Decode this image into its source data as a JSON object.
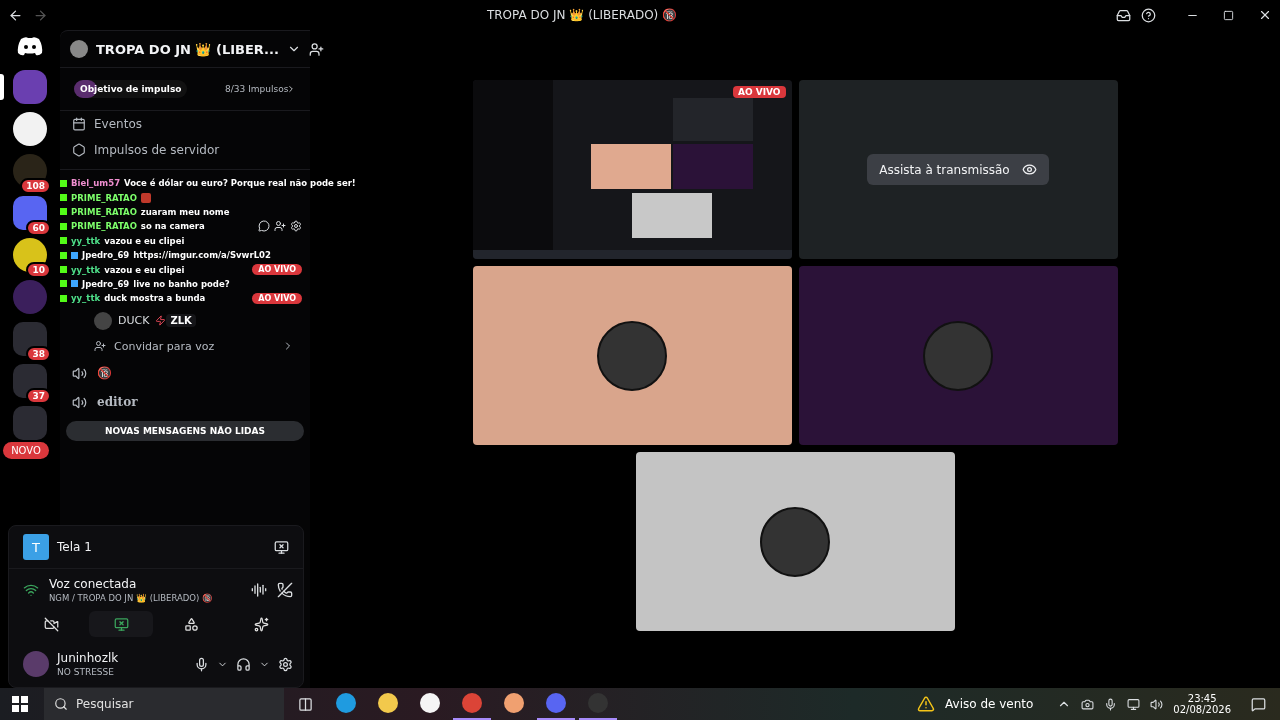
{
  "window": {
    "title": "TROPA DO JN 👑 (LIBERADO) 🔞"
  },
  "servers": [
    {
      "kind": "avatar",
      "selected": true,
      "color": "#6a3fb0"
    },
    {
      "kind": "logo",
      "selected": false,
      "color": "#f2f2f2"
    },
    {
      "kind": "logo",
      "selected": false,
      "color": "#2a2418",
      "badge": "108"
    },
    {
      "kind": "folder",
      "selected": false,
      "color": "#5865f2",
      "badge": "60"
    },
    {
      "kind": "logo",
      "selected": false,
      "color": "#d8c21a",
      "badge": "10"
    },
    {
      "kind": "logo",
      "selected": false,
      "color": "#3b1f5c"
    },
    {
      "kind": "folder",
      "selected": false,
      "color": "#2b2b33",
      "badge": "38"
    },
    {
      "kind": "folder",
      "selected": false,
      "color": "#2b2b33",
      "badge": "37"
    },
    {
      "kind": "folder",
      "selected": false,
      "color": "#2b2b33"
    }
  ],
  "new_pill": "NOVO",
  "server_header": {
    "name": "TROPA DO JN 👑 (LIBER..."
  },
  "boost": {
    "label": "Objetivo de impulso",
    "progress": "8/33 Impulsos",
    "level": 0.2
  },
  "menu": [
    {
      "kind": "calendar",
      "label": "Eventos"
    },
    {
      "kind": "boost",
      "label": "Impulsos de servidor"
    }
  ],
  "chat_overlay": [
    {
      "user": "Biel_um57",
      "color": "#f08fd0",
      "message": "Voce é dólar ou euro? Porque real não pode ser!",
      "extra_badge": false
    },
    {
      "user": "PRIME_RATAO",
      "color": "#7dff6b",
      "emote": true,
      "extra_badge": false
    },
    {
      "user": "PRIME_RATAO",
      "color": "#7dff6b",
      "message": "zuaram meu nome",
      "extra_badge": false
    },
    {
      "user": "PRIME_RATAO",
      "color": "#7dff6b",
      "message": "so na camera",
      "extra_badge": false,
      "beside": {
        "kind": "actions"
      }
    },
    {
      "user": "yy_ttk",
      "color": "#4fe08a",
      "message": "vazou e eu clipei",
      "extra_badge": false
    },
    {
      "user": "Jpedro_69",
      "color": "#ffffff",
      "message": "https://imgur.com/a/SvwrL02",
      "extra_badge": true
    },
    {
      "user": "yy_ttk",
      "color": "#4fe08a",
      "message": "vazou e eu clipei",
      "extra_badge": false,
      "beside": {
        "kind": "live",
        "label": "AO VIVO"
      }
    },
    {
      "user": "Jpedro_69",
      "color": "#ffffff",
      "message": "live no banho pode?",
      "extra_badge": true
    },
    {
      "user": "yy_ttk",
      "color": "#4fe08a",
      "message": "duck mostra a bunda",
      "extra_badge": false,
      "beside": {
        "kind": "live",
        "label": "AO VIVO"
      }
    }
  ],
  "voice_member": {
    "name": "DUCK",
    "tag": "ZLK"
  },
  "invite": {
    "label": "Convidar para voz"
  },
  "voice_channels": [
    {
      "name": "🔞"
    },
    {
      "name": "editor"
    }
  ],
  "unread_banner": "NOVAS MENSAGENS NÃO LIDAS",
  "stream": {
    "initial": "T",
    "name": "Tela 1"
  },
  "voice": {
    "status": "Voz conectada",
    "channel": "NGM / TROPA DO JN 👑 (LIBERADO) 🔞"
  },
  "voice_buttons": [
    {
      "kind": "camera-off",
      "selected": false
    },
    {
      "kind": "screen",
      "selected": true
    },
    {
      "kind": "activities",
      "selected": false
    },
    {
      "kind": "soundboard",
      "selected": false
    }
  ],
  "user": {
    "name": "Juninhozlk",
    "status": "NO STRESSE"
  },
  "tiles": [
    {
      "kind": "screen",
      "badge": "AO VIVO"
    },
    {
      "kind": "preview",
      "button": "Assista à transmissão"
    },
    {
      "kind": "avatar",
      "color": "#d9a58c"
    },
    {
      "kind": "avatar",
      "color": "#2b1238"
    },
    {
      "kind": "avatar",
      "color": "#c4c4c4"
    }
  ],
  "taskbar": {
    "search": "Pesquisar",
    "weather": "Aviso de vento",
    "time": "23:45",
    "date": "02/08/2026",
    "apps": [
      {
        "kind": "edge",
        "active": false
      },
      {
        "kind": "folder",
        "active": false
      },
      {
        "kind": "store",
        "active": false
      },
      {
        "kind": "chrome",
        "active": true
      },
      {
        "kind": "spiral",
        "active": false
      },
      {
        "kind": "discord",
        "active": true
      },
      {
        "kind": "obs",
        "active": true
      }
    ]
  }
}
